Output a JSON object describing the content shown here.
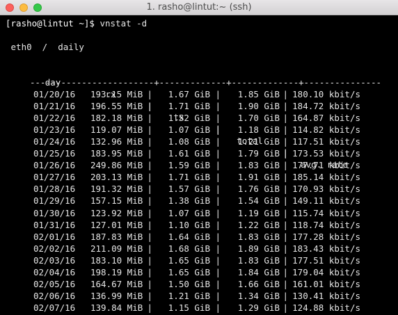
{
  "window": {
    "title": "1. rasho@lintut:~ (ssh)"
  },
  "terminal": {
    "prompt": "[rasho@lintut ~]$",
    "command": "vnstat -d",
    "interface_line": " eth0  /  daily",
    "header": {
      "day": "day",
      "rx": "rx",
      "tx": "tx",
      "total": "total",
      "avg_rate": "avg. rate",
      "sep": "|"
    },
    "divider": "------------------------+-------------+-------------+---------------",
    "rows": [
      {
        "day": "01/20/16",
        "rx": "193.15 MiB",
        "tx": "1.67 GiB",
        "total": "1.85 GiB",
        "rate": "180.10 kbit/s"
      },
      {
        "day": "01/21/16",
        "rx": "196.55 MiB",
        "tx": "1.71 GiB",
        "total": "1.90 GiB",
        "rate": "184.72 kbit/s"
      },
      {
        "day": "01/22/16",
        "rx": "182.18 MiB",
        "tx": "1.52 GiB",
        "total": "1.70 GiB",
        "rate": "164.87 kbit/s"
      },
      {
        "day": "01/23/16",
        "rx": "119.07 MiB",
        "tx": "1.07 GiB",
        "total": "1.18 GiB",
        "rate": "114.82 kbit/s"
      },
      {
        "day": "01/24/16",
        "rx": "132.96 MiB",
        "tx": "1.08 GiB",
        "total": "1.21 GiB",
        "rate": "117.51 kbit/s"
      },
      {
        "day": "01/25/16",
        "rx": "183.95 MiB",
        "tx": "1.61 GiB",
        "total": "1.79 GiB",
        "rate": "173.53 kbit/s"
      },
      {
        "day": "01/26/16",
        "rx": "249.86 MiB",
        "tx": "1.59 GiB",
        "total": "1.83 GiB",
        "rate": "177.71 kbit/s"
      },
      {
        "day": "01/27/16",
        "rx": "203.13 MiB",
        "tx": "1.71 GiB",
        "total": "1.91 GiB",
        "rate": "185.14 kbit/s"
      },
      {
        "day": "01/28/16",
        "rx": "191.32 MiB",
        "tx": "1.57 GiB",
        "total": "1.76 GiB",
        "rate": "170.93 kbit/s"
      },
      {
        "day": "01/29/16",
        "rx": "157.15 MiB",
        "tx": "1.38 GiB",
        "total": "1.54 GiB",
        "rate": "149.11 kbit/s"
      },
      {
        "day": "01/30/16",
        "rx": "123.92 MiB",
        "tx": "1.07 GiB",
        "total": "1.19 GiB",
        "rate": "115.74 kbit/s"
      },
      {
        "day": "01/31/16",
        "rx": "127.01 MiB",
        "tx": "1.10 GiB",
        "total": "1.22 GiB",
        "rate": "118.74 kbit/s"
      },
      {
        "day": "02/01/16",
        "rx": "187.83 MiB",
        "tx": "1.64 GiB",
        "total": "1.83 GiB",
        "rate": "177.28 kbit/s"
      },
      {
        "day": "02/02/16",
        "rx": "211.09 MiB",
        "tx": "1.68 GiB",
        "total": "1.89 GiB",
        "rate": "183.43 kbit/s"
      },
      {
        "day": "02/03/16",
        "rx": "183.10 MiB",
        "tx": "1.65 GiB",
        "total": "1.83 GiB",
        "rate": "177.51 kbit/s"
      },
      {
        "day": "02/04/16",
        "rx": "198.19 MiB",
        "tx": "1.65 GiB",
        "total": "1.84 GiB",
        "rate": "179.04 kbit/s"
      },
      {
        "day": "02/05/16",
        "rx": "164.67 MiB",
        "tx": "1.50 GiB",
        "total": "1.66 GiB",
        "rate": "161.01 kbit/s"
      },
      {
        "day": "02/06/16",
        "rx": "136.99 MiB",
        "tx": "1.21 GiB",
        "total": "1.34 GiB",
        "rate": "130.41 kbit/s"
      },
      {
        "day": "02/07/16",
        "rx": "139.84 MiB",
        "tx": "1.15 GiB",
        "total": "1.29 GiB",
        "rate": "124.88 kbit/s"
      }
    ]
  }
}
